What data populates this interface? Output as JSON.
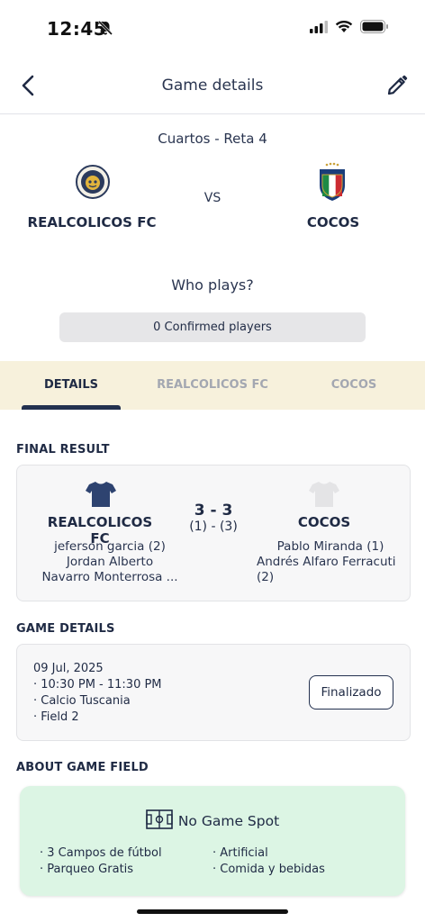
{
  "status_bar": {
    "time": "12:45"
  },
  "header": {
    "title": "Game details"
  },
  "match": {
    "round": "Cuartos - Reta 4",
    "home_team": "REALCOLICOS FC",
    "away_team": "COCOS",
    "vs": "VS"
  },
  "players": {
    "question": "Who plays?",
    "confirmed_label": "0 Confirmed players"
  },
  "tabs": [
    {
      "label": "DETAILS",
      "active": true
    },
    {
      "label": "REALCOLICOS FC",
      "active": false
    },
    {
      "label": "COCOS",
      "active": false
    }
  ],
  "final_result": {
    "section_label": "FINAL RESULT",
    "home_team": "REALCOLICOS FC",
    "away_team": "COCOS",
    "score": "3 - 3",
    "half_time": "(1) - (3)",
    "home_shirt_color": "#2e4370",
    "away_shirt_color": "#e4e4e6",
    "home_scorers": [
      "jeferson garcia (2)",
      "Jordan Alberto",
      "Navarro Monterrosa ..."
    ],
    "away_scorers": [
      "Pablo  Miranda (1)",
      "Andrés Alfaro Ferracuti",
      "(2)"
    ]
  },
  "game_details": {
    "section_label": "GAME DETAILS",
    "date": "09 Jul, 2025",
    "time": "· 10:30 PM - 11:30 PM",
    "venue": "· Calcio Tuscania",
    "field": "· Field 2",
    "status": "Finalizado"
  },
  "game_field": {
    "section_label": "ABOUT GAME FIELD",
    "title": "No Game Spot",
    "amenities_left": [
      "· 3 Campos de fútbol",
      "· Parqueo Gratis"
    ],
    "amenities_right": [
      "· Artificial",
      "· Comida y bebidas"
    ],
    "background": "#dcf5e4"
  },
  "colors": {
    "accent": "#23314f",
    "tab_bar": "#f7f1dc"
  }
}
